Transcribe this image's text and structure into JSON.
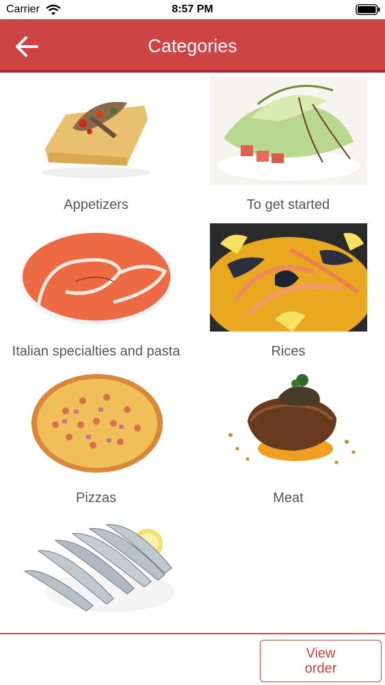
{
  "status_bar": {
    "carrier": "Carrier",
    "time": "8:57 PM",
    "icons": [
      "wifi-icon",
      "battery-icon"
    ]
  },
  "nav": {
    "title": "Categories",
    "back_icon": "arrow-left-icon",
    "background_color": "#cc4444"
  },
  "categories": [
    {
      "label": "Appetizers",
      "image": "appetizer-photo"
    },
    {
      "label": "To get started",
      "image": "salad-photo"
    },
    {
      "label": "Italian specialties and pasta",
      "image": "soup-photo"
    },
    {
      "label": "Rices",
      "image": "paella-photo"
    },
    {
      "label": "Pizzas",
      "image": "pizza-photo"
    },
    {
      "label": "Meat",
      "image": "steak-photo"
    },
    {
      "label": "",
      "image": "fish-photo"
    }
  ],
  "footer": {
    "view_order_line1": "View",
    "view_order_line2": "order",
    "accent_color": "#cc4444"
  }
}
